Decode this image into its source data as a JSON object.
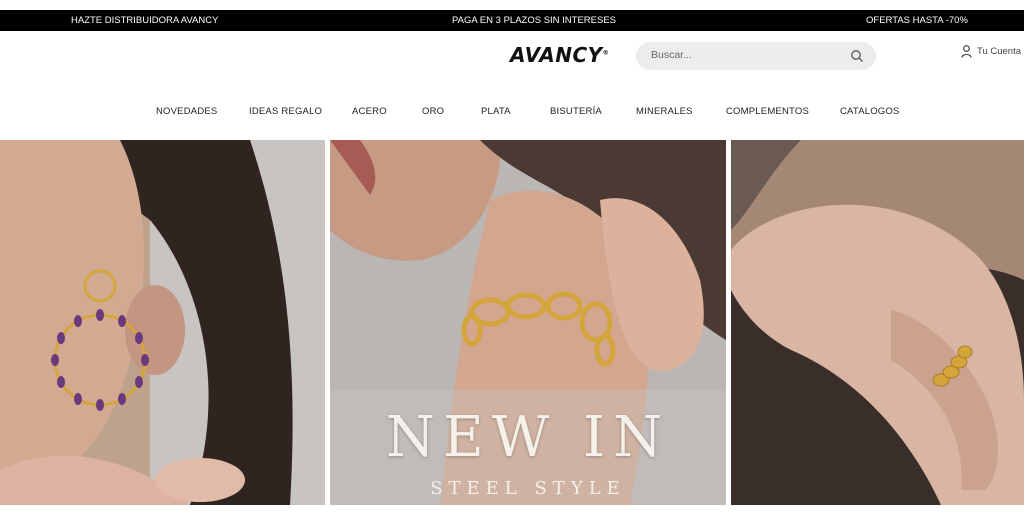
{
  "promo_bar": {
    "left": "HAZTE DISTRIBUIDORA AVANCY",
    "center": "PAGA EN 3 PLAZOS SIN INTERESES",
    "right": "OFERTAS HASTA -70%"
  },
  "header": {
    "logo": "AVANCY",
    "search_placeholder": "Buscar...",
    "account_label": "Tu Cuenta"
  },
  "nav": {
    "items": [
      "NOVEDADES",
      "IDEAS REGALO",
      "ACERO",
      "ORO",
      "PLATA",
      "BISUTERÍA",
      "MINERALES",
      "COMPLEMENTOS",
      "CATALOGOS"
    ]
  },
  "hero": {
    "title": "NEW IN",
    "subtitle": "STEEL STYLE"
  },
  "icons": {
    "search": "search-icon",
    "account": "user-icon"
  },
  "colors": {
    "promo_bg": "#000000",
    "search_bg": "#ececec",
    "gold": "#d4a53a"
  }
}
